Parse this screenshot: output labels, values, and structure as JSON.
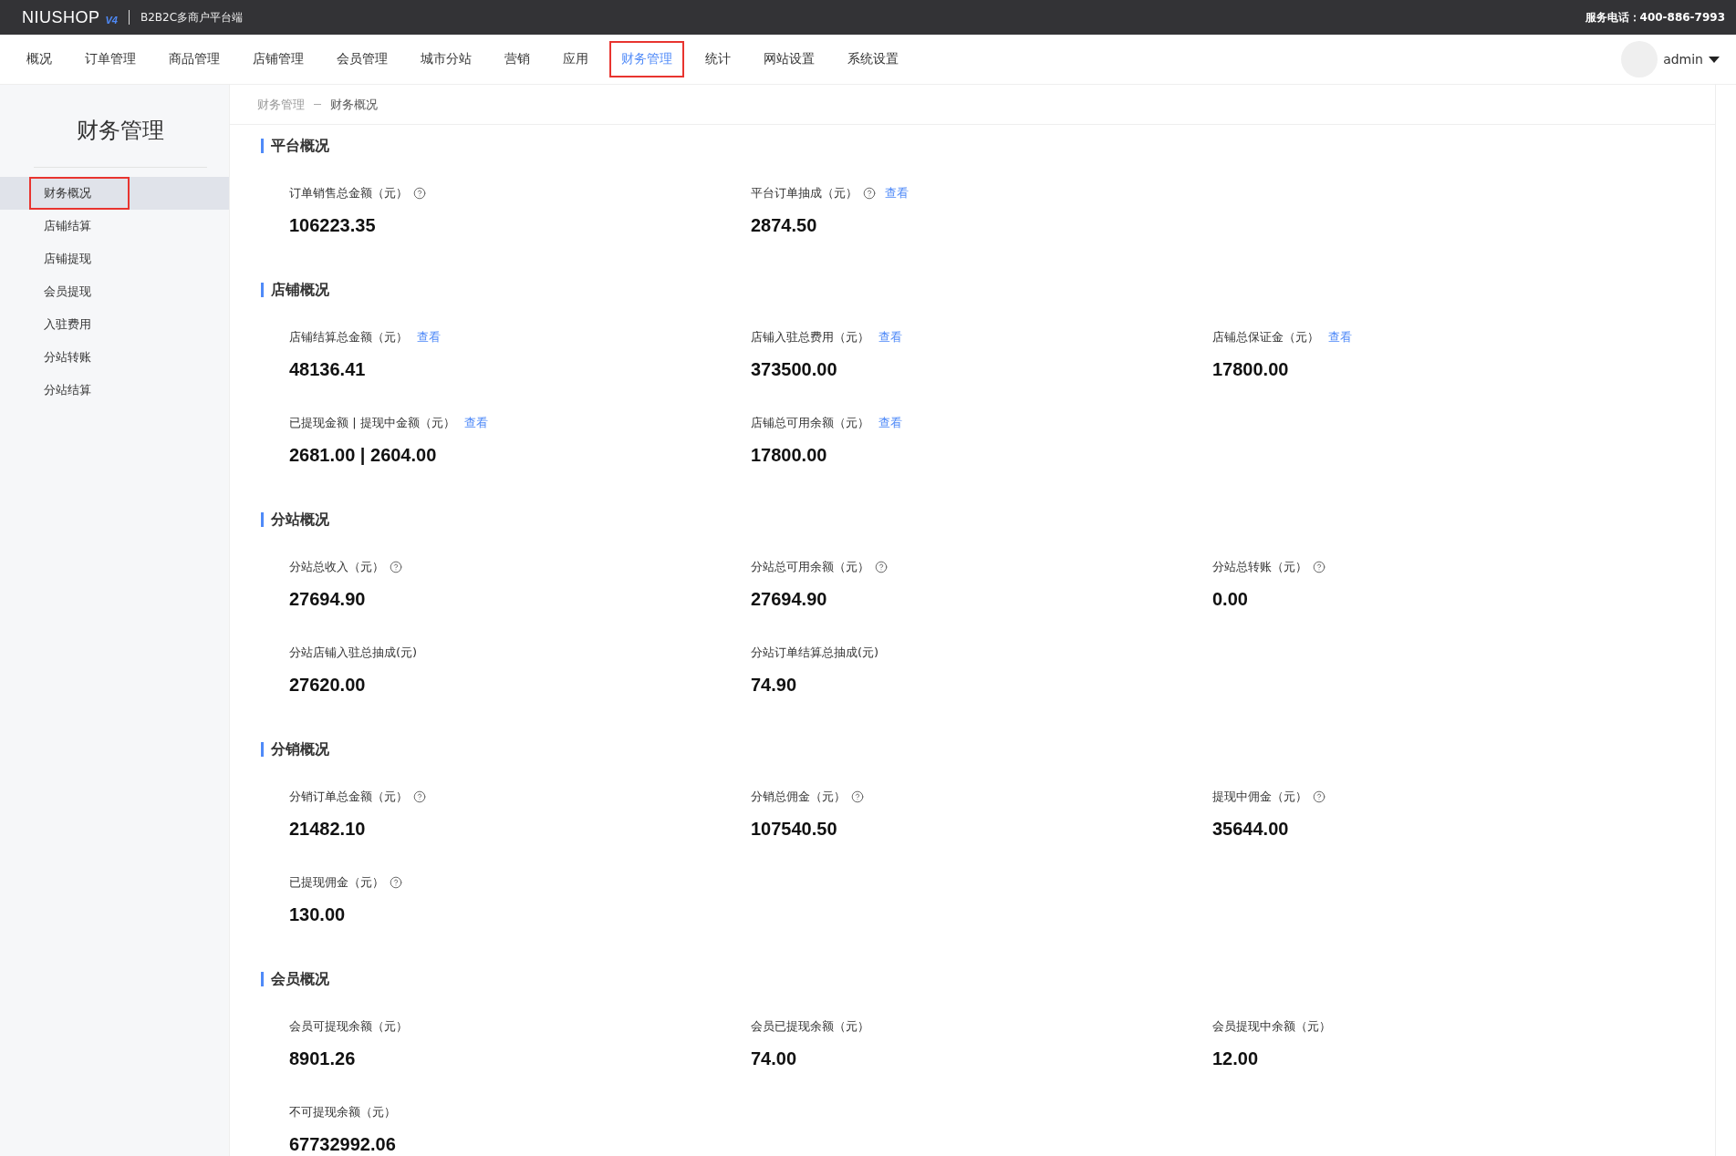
{
  "topbar": {
    "logo": "NIUSHOP",
    "logo_version": "V4",
    "platform": "B2B2C多商户平台端",
    "service_label": "服务电话：",
    "service_phone": "400-886-7993"
  },
  "nav": [
    {
      "label": "概况",
      "selected": false
    },
    {
      "label": "订单管理",
      "selected": false
    },
    {
      "label": "商品管理",
      "selected": false
    },
    {
      "label": "店铺管理",
      "selected": false
    },
    {
      "label": "会员管理",
      "selected": false
    },
    {
      "label": "城市分站",
      "selected": false
    },
    {
      "label": "营销",
      "selected": false
    },
    {
      "label": "应用",
      "selected": false
    },
    {
      "label": "财务管理",
      "selected": true
    },
    {
      "label": "统计",
      "selected": false
    },
    {
      "label": "网站设置",
      "selected": false
    },
    {
      "label": "系统设置",
      "selected": false
    }
  ],
  "user": {
    "name": "admin"
  },
  "sidebar": {
    "title": "财务管理",
    "items": [
      {
        "label": "财务概况",
        "selected": true
      },
      {
        "label": "店铺结算",
        "selected": false
      },
      {
        "label": "店铺提现",
        "selected": false
      },
      {
        "label": "会员提现",
        "selected": false
      },
      {
        "label": "入驻费用",
        "selected": false
      },
      {
        "label": "分站转账",
        "selected": false
      },
      {
        "label": "分站结算",
        "selected": false
      }
    ]
  },
  "breadcrumb": [
    "财务管理",
    "财务概况"
  ],
  "sections": [
    {
      "title": "平台概况",
      "items": [
        {
          "label": "订单销售总金额（元）",
          "help": true,
          "value": "106223.35"
        },
        {
          "label": "平台订单抽成（元）",
          "help": true,
          "link": "查看",
          "value": "2874.50"
        }
      ]
    },
    {
      "title": "店铺概况",
      "items": [
        {
          "label": "店铺结算总金额（元）",
          "help": false,
          "link": "查看",
          "value": "48136.41"
        },
        {
          "label": "店铺入驻总费用（元）",
          "help": false,
          "link": "查看",
          "value": "373500.00"
        },
        {
          "label": "店铺总保证金（元）",
          "help": false,
          "link": "查看",
          "value": "17800.00"
        },
        {
          "label": "已提现金额 | 提现中金额（元）",
          "help": false,
          "link": "查看",
          "value": "2681.00 | 2604.00"
        },
        {
          "label": "店铺总可用余额（元）",
          "help": false,
          "link": "查看",
          "value": "17800.00"
        }
      ]
    },
    {
      "title": "分站概况",
      "items": [
        {
          "label": "分站总收入（元）",
          "help": true,
          "value": "27694.90"
        },
        {
          "label": "分站总可用余额（元）",
          "help": true,
          "value": "27694.90"
        },
        {
          "label": "分站总转账（元）",
          "help": true,
          "value": "0.00"
        },
        {
          "label": "分站店铺入驻总抽成(元)",
          "help": false,
          "value": "27620.00"
        },
        {
          "label": "分站订单结算总抽成(元)",
          "help": false,
          "value": "74.90"
        }
      ]
    },
    {
      "title": "分销概况",
      "items": [
        {
          "label": "分销订单总金额（元）",
          "help": true,
          "value": "21482.10"
        },
        {
          "label": "分销总佣金（元）",
          "help": true,
          "value": "107540.50"
        },
        {
          "label": "提现中佣金（元）",
          "help": true,
          "value": "35644.00"
        },
        {
          "label": "已提现佣金（元）",
          "help": true,
          "value": "130.00"
        }
      ]
    },
    {
      "title": "会员概况",
      "items": [
        {
          "label": "会员可提现余额（元）",
          "help": false,
          "value": "8901.26"
        },
        {
          "label": "会员已提现余额（元）",
          "help": false,
          "value": "74.00"
        },
        {
          "label": "会员提现中余额（元）",
          "help": false,
          "value": "12.00"
        },
        {
          "label": "不可提现余额（元）",
          "help": false,
          "value": "67732992.06"
        }
      ]
    }
  ]
}
